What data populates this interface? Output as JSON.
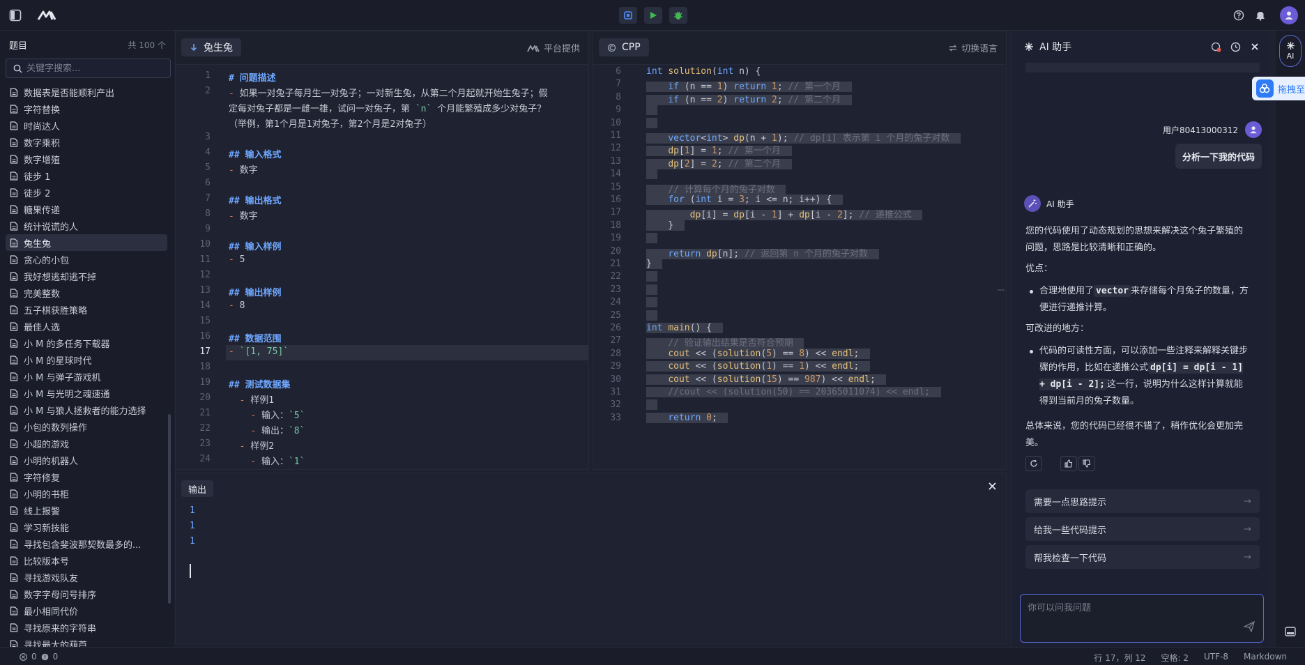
{
  "colors": {
    "accent": "#6fa8ff",
    "bg": "#1e2130",
    "run_green": "#3fb950",
    "debug_green": "#3fb950",
    "stop_blue": "#4d8cff",
    "ai_border": "#5a6ad6"
  },
  "sidebar": {
    "title": "题目",
    "count": "共 100 个",
    "search_placeholder": "关键字搜索...",
    "items": [
      "数据表是否能顺利产出",
      "字符替换",
      "时尚达人",
      "数字乘积",
      "数字增殖",
      "徒步 1",
      "徒步 2",
      "糖果传递",
      "统计说谎的人",
      "兔生兔",
      "贪心的小包",
      "我好想逃却逃不掉",
      "完美整数",
      "五子棋获胜策略",
      "最佳人选",
      "小 M 的多任务下载器",
      "小 M 的星球时代",
      "小 M 与弹子游戏机",
      "小 M 与光明之魂速通",
      "小 M 与狼人拯救者的能力选择",
      "小包的数列操作",
      "小超的游戏",
      "小明的机器人",
      "字符修复",
      "小明的书柜",
      "线上报警",
      "学习新技能",
      "寻找包含斐波那契数最多的...",
      "比较版本号",
      "寻找游戏队友",
      "数字字母问号排序",
      "最小相同代价",
      "寻找原来的字符串",
      "寻找最大的葫芦"
    ],
    "active_index": 9
  },
  "problem": {
    "title": "兔生兔",
    "source": "平台提供",
    "current_line": 17,
    "lines": [
      {
        "n": 1,
        "t": "# 问题描述",
        "k": "h"
      },
      {
        "n": 2,
        "t": "- 如果一对兔子每月生一对兔子；一对新生兔，从第二个月起就开始生兔子；假",
        "k": "d"
      },
      {
        "n": null,
        "t": "定每对兔子都是一雌一雄，试问一对兔子，第 `n` 个月能繁殖成多少对兔子？",
        "k": "c"
      },
      {
        "n": null,
        "t": "（举例，第1个月是1对兔子，第2个月是2对兔子）",
        "k": "c"
      },
      {
        "n": 3,
        "t": "",
        "k": "p"
      },
      {
        "n": 4,
        "t": "## 输入格式",
        "k": "h"
      },
      {
        "n": 5,
        "t": "- 数字",
        "k": "d"
      },
      {
        "n": 6,
        "t": "",
        "k": "p"
      },
      {
        "n": 7,
        "t": "## 输出格式",
        "k": "h"
      },
      {
        "n": 8,
        "t": "- 数字",
        "k": "d"
      },
      {
        "n": 9,
        "t": "",
        "k": "p"
      },
      {
        "n": 10,
        "t": "## 输入样例",
        "k": "h"
      },
      {
        "n": 11,
        "t": "- 5",
        "k": "d"
      },
      {
        "n": 12,
        "t": "",
        "k": "p"
      },
      {
        "n": 13,
        "t": "## 输出样例",
        "k": "h"
      },
      {
        "n": 14,
        "t": "- 8",
        "k": "d"
      },
      {
        "n": 15,
        "t": "",
        "k": "p"
      },
      {
        "n": 16,
        "t": "## 数据范围",
        "k": "h"
      },
      {
        "n": 17,
        "t": "- `[1, 75]`",
        "k": "d"
      },
      {
        "n": 18,
        "t": "",
        "k": "p"
      },
      {
        "n": 19,
        "t": "## 测试数据集",
        "k": "h"
      },
      {
        "n": 20,
        "t": "  - 样例1",
        "k": "d"
      },
      {
        "n": 21,
        "t": "    - 输入：`5`",
        "k": "d"
      },
      {
        "n": 22,
        "t": "    - 输出：`8`",
        "k": "d"
      },
      {
        "n": 23,
        "t": "  - 样例2",
        "k": "d"
      },
      {
        "n": 24,
        "t": "    - 输入：`1`",
        "k": "d"
      }
    ]
  },
  "editor": {
    "language": "CPP",
    "switch_label": "切换语言",
    "lines": [
      {
        "n": 6,
        "t": "int solution(int n) {"
      },
      {
        "n": 7,
        "t": "    if (n == 1) return 1; // 第一个月"
      },
      {
        "n": 8,
        "t": "    if (n == 2) return 2; // 第二个月"
      },
      {
        "n": 9,
        "t": ""
      },
      {
        "n": 10,
        "t": ""
      },
      {
        "n": 11,
        "t": "    vector<int> dp(n + 1); // dp[i] 表示第 i 个月的兔子对数"
      },
      {
        "n": 12,
        "t": "    dp[1] = 1; // 第一个月"
      },
      {
        "n": 13,
        "t": "    dp[2] = 2; // 第二个月"
      },
      {
        "n": 14,
        "t": ""
      },
      {
        "n": 15,
        "t": "    // 计算每个月的兔子对数"
      },
      {
        "n": 16,
        "t": "    for (int i = 3; i <= n; i++) {"
      },
      {
        "n": 17,
        "t": "        dp[i] = dp[i - 1] + dp[i - 2]; // 递推公式"
      },
      {
        "n": 18,
        "t": "    }"
      },
      {
        "n": 19,
        "t": ""
      },
      {
        "n": 20,
        "t": "    return dp[n]; // 返回第 n 个月的兔子对数"
      },
      {
        "n": 21,
        "t": "}"
      },
      {
        "n": 22,
        "t": ""
      },
      {
        "n": 23,
        "t": ""
      },
      {
        "n": 24,
        "t": ""
      },
      {
        "n": 25,
        "t": ""
      },
      {
        "n": 26,
        "t": "int main() {"
      },
      {
        "n": 27,
        "t": "    // 验证输出结果是否符合预期"
      },
      {
        "n": 28,
        "t": "    cout << (solution(5) == 8) << endl;"
      },
      {
        "n": 29,
        "t": "    cout << (solution(1) == 1) << endl;"
      },
      {
        "n": 30,
        "t": "    cout << (solution(15) == 987) << endl;"
      },
      {
        "n": 31,
        "t": "    //cout << (solution(50) == 20365011074) << endl;"
      },
      {
        "n": 32,
        "t": ""
      },
      {
        "n": 33,
        "t": "    return 0;"
      }
    ]
  },
  "output": {
    "title": "输出",
    "lines": [
      "1",
      "1",
      "1"
    ]
  },
  "ai": {
    "title": "AI 助手",
    "user_name": "用户80413000312",
    "user_message": "分析一下我的代码",
    "assistant_name": "AI 助手",
    "p1": "您的代码使用了动态规划的思想来解决这个兔子繁殖的问题，思路是比较清晰和正确的。",
    "pros_title": "优点：",
    "pro1_a": "合理地使用了",
    "pro1_code": "vector",
    "pro1_b": "来存储每个月兔子的数量，方便进行递推计算。",
    "improve_title": "可改进的地方：",
    "imp1_a": "代码的可读性方面，可以添加一些注释来解释关键步骤的作用，比如在递推公式",
    "imp1_code": "dp[i] = dp[i - 1] + dp[i - 2];",
    "imp1_b": "这一行，说明为什么这样计算就能得到当前月的兔子数量。",
    "summary": "总体来说，您的代码已经很不错了，稍作优化会更加完美。",
    "suggestions": [
      "需要一点思路提示",
      "给我一些代码提示",
      "帮我检查一下代码"
    ],
    "input_placeholder": "你可以问我问题",
    "rail_label": "AI",
    "drag_tip": "拖拽至"
  },
  "status": {
    "errors": "0",
    "warnings": "0",
    "position": "行 17，列 12",
    "spaces": "空格: 2",
    "encoding": "UTF-8",
    "mode": "Markdown"
  }
}
